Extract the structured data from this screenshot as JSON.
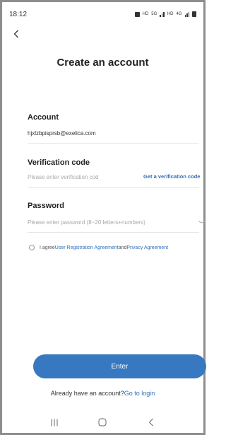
{
  "status_bar": {
    "time": "18:12",
    "icons": [
      "alarm-icon",
      "hd-icon",
      "5g-icon",
      "signal-icon",
      "hd-icon",
      "4g-icon",
      "signal-icon",
      "battery-icon"
    ]
  },
  "header": {
    "back_icon": "chevron-left-icon",
    "title": "Create an account"
  },
  "account": {
    "label": "Account",
    "value": "hjxlzbpisprsb@exelica.com"
  },
  "verification": {
    "label": "Verification code",
    "placeholder": "Please enter verification cod",
    "get_code": "Get a verification code"
  },
  "password": {
    "label": "Password",
    "placeholder": "Please enter password (8~20 letters+numbers)",
    "toggle_icon": "eye-closed-icon"
  },
  "agreement": {
    "prefix": "I agree",
    "user_agreement": "User Registration Agreement",
    "and": "and",
    "privacy_agreement": "Privacy Agreement"
  },
  "enter_button": {
    "label": "Enter"
  },
  "login_prompt": {
    "text": "Already have an account?",
    "link": "Go to login"
  },
  "nav_bar": {
    "items": [
      "recent-apps-icon",
      "home-icon",
      "back-icon"
    ]
  },
  "colors": {
    "accent": "#3778c0",
    "link": "#2f6fb7",
    "placeholder": "#a8a8a8"
  }
}
